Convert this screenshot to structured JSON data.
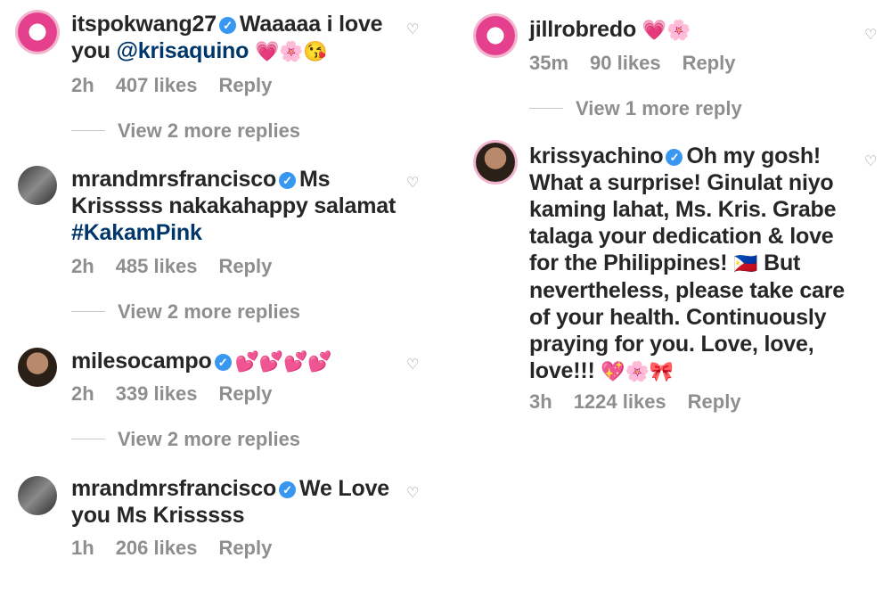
{
  "comments_left": [
    {
      "username": "itspokwang27",
      "verified": true,
      "text": "Waaaaa i love you",
      "mention": "@krisaquino",
      "emojis": "💗🌸😘",
      "time": "2h",
      "likes": "407 likes",
      "reply": "Reply",
      "view_more": "View 2 more replies"
    },
    {
      "username": "mrandmrsfrancisco",
      "verified": true,
      "text": "Ms Krisssss nakakahappy salamat",
      "hashtag": "#KakamPink",
      "time": "2h",
      "likes": "485 likes",
      "reply": "Reply",
      "view_more": "View 2 more replies"
    },
    {
      "username": "milesocampo",
      "verified": true,
      "emojis": "💕💕💕💕",
      "time": "2h",
      "likes": "339 likes",
      "reply": "Reply",
      "view_more": "View 2 more replies"
    },
    {
      "username": "mrandmrsfrancisco",
      "verified": true,
      "text": "We Love you Ms Krisssss",
      "time": "1h",
      "likes": "206 likes",
      "reply": "Reply"
    }
  ],
  "comments_right": [
    {
      "username": "jillrobredo",
      "verified": false,
      "emojis": "💗🌸",
      "time": "35m",
      "likes": "90 likes",
      "reply": "Reply",
      "view_more": "View 1 more reply"
    },
    {
      "username": "krissyachino",
      "verified": true,
      "text_lines": [
        "Oh my gosh!",
        "What a surprise! Ginulat niyo",
        "kaming lahat, Ms. Kris. Grabe",
        "talaga your dedication & love",
        "for the Philippines!",
        "But",
        "nevertheless, please take care",
        "of your health. Continuously",
        "praying for you. Love, love,",
        "love!!!"
      ],
      "flag_emoji": "🇵🇭",
      "end_emojis": "💖🌸🎀",
      "time": "3h",
      "likes": "1224 likes",
      "reply": "Reply"
    }
  ],
  "icons": {
    "like": "heart-outline-icon",
    "verified": "verified-badge-icon"
  },
  "colors": {
    "username": "#262626",
    "meta": "#8e8e8e",
    "link": "#00376b",
    "verified": "#3897f0"
  }
}
